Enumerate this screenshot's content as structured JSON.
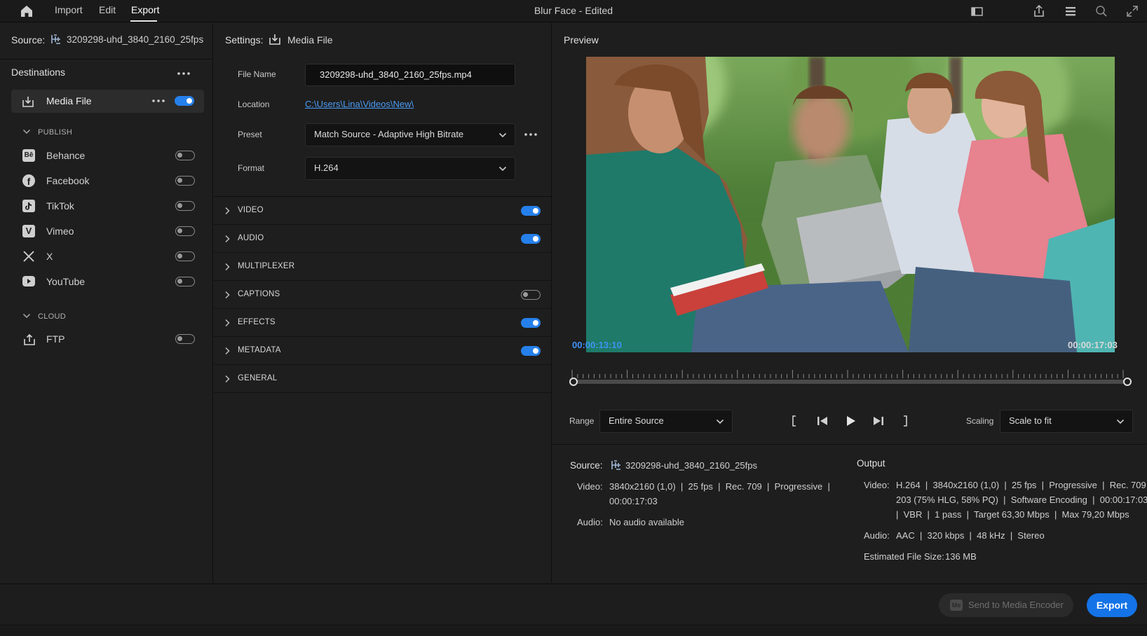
{
  "menu": {
    "home_icon": "home-icon",
    "import": "Import",
    "edit": "Edit",
    "export": "Export"
  },
  "document": {
    "name": "Blur Face",
    "status": " - Edited"
  },
  "source": {
    "label": "Source:",
    "name": "3209298-uhd_3840_2160_25fps"
  },
  "destinations": {
    "title": "Destinations",
    "media_file": {
      "label": "Media File",
      "enabled": true
    },
    "publish_header": "PUBLISH",
    "publish": [
      {
        "label": "Behance",
        "icon": "behance-icon",
        "enabled": false
      },
      {
        "label": "Facebook",
        "icon": "facebook-icon",
        "enabled": false
      },
      {
        "label": "TikTok",
        "icon": "tiktok-icon",
        "enabled": false
      },
      {
        "label": "Vimeo",
        "icon": "vimeo-icon",
        "enabled": false
      },
      {
        "label": "X",
        "icon": "x-icon",
        "enabled": false
      },
      {
        "label": "YouTube",
        "icon": "youtube-icon",
        "enabled": false
      }
    ],
    "cloud_header": "CLOUD",
    "cloud": [
      {
        "label": "FTP",
        "icon": "ftp-upload-icon",
        "enabled": false
      }
    ]
  },
  "settings": {
    "label": "Settings:",
    "target": "Media File",
    "file_name_label": "File Name",
    "file_name": "3209298-uhd_3840_2160_25fps.mp4",
    "location_label": "Location",
    "location": "C:\\Users\\Lina\\Videos\\New\\",
    "preset_label": "Preset",
    "preset": "Match Source - Adaptive High Bitrate",
    "format_label": "Format",
    "format": "H.264",
    "sections": [
      {
        "label": "VIDEO",
        "toggle": "on"
      },
      {
        "label": "AUDIO",
        "toggle": "on"
      },
      {
        "label": "MULTIPLEXER",
        "toggle": "none"
      },
      {
        "label": "CAPTIONS",
        "toggle": "off"
      },
      {
        "label": "EFFECTS",
        "toggle": "on"
      },
      {
        "label": "METADATA",
        "toggle": "on"
      },
      {
        "label": "GENERAL",
        "toggle": "none"
      }
    ]
  },
  "preview": {
    "title": "Preview",
    "current_time": "00:00:13:10",
    "duration": "00:00:17:03",
    "range_label": "Range",
    "range_value": "Entire Source",
    "scaling_label": "Scaling",
    "scaling_value": "Scale to fit"
  },
  "source_info": {
    "label": "Source:",
    "name": "3209298-uhd_3840_2160_25fps",
    "video_label": "Video:",
    "video_line1": "3840x2160 (1,0)  |  25 fps  |  Rec. 709  |  Progressive  |",
    "video_line2": "00:00:17:03",
    "audio_label": "Audio:",
    "audio": "No audio available"
  },
  "output_info": {
    "title": "Output",
    "video_label": "Video:",
    "video_line1": "H.264  |  3840x2160 (1,0)  |  25 fps  |  Progressive  |  Rec. 709  |",
    "video_line2": "203 (75% HLG, 58% PQ)  |  Software Encoding  |  00:00:17:03",
    "video_line3": "|  VBR  |  1 pass  |  Target 63,30 Mbps  |  Max 79,20 Mbps",
    "audio_label": "Audio:",
    "audio": "AAC  |  320 kbps  |  48 kHz  |  Stereo",
    "size_label": "Estimated File Size:",
    "size": "136 MB"
  },
  "footer": {
    "send_label": "Send to Media Encoder",
    "export_label": "Export"
  }
}
